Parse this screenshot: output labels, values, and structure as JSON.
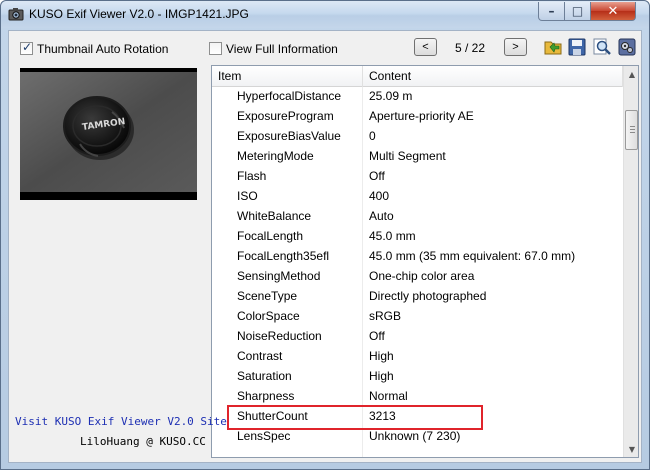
{
  "window": {
    "title": "KUSO Exif Viewer V2.0 - IMGP1421.JPG",
    "minimize_glyph": "–",
    "maximize_glyph": "□",
    "close_glyph": "✕"
  },
  "toolbar": {
    "thumbnail_auto_rotation": {
      "label": "Thumbnail Auto Rotation",
      "checked": true
    },
    "view_full_information": {
      "label": "View Full Information",
      "checked": false
    },
    "prev_glyph": "<",
    "next_glyph": ">",
    "page_indicator": "5 / 22",
    "tools": [
      "open-folder-icon",
      "save-icon",
      "search-icon",
      "settings-icon"
    ]
  },
  "list": {
    "columns": [
      "Item",
      "Content"
    ],
    "rows": [
      {
        "item": "HyperfocalDistance",
        "content": "25.09 m"
      },
      {
        "item": "ExposureProgram",
        "content": "Aperture-priority AE"
      },
      {
        "item": "ExposureBiasValue",
        "content": "0"
      },
      {
        "item": "MeteringMode",
        "content": "Multi Segment"
      },
      {
        "item": "Flash",
        "content": "Off"
      },
      {
        "item": "ISO",
        "content": "400"
      },
      {
        "item": "WhiteBalance",
        "content": "Auto"
      },
      {
        "item": "FocalLength",
        "content": "45.0 mm"
      },
      {
        "item": "FocalLength35efl",
        "content": "45.0 mm (35 mm equivalent: 67.0 mm)"
      },
      {
        "item": "SensingMethod",
        "content": "One-chip color area"
      },
      {
        "item": "SceneType",
        "content": "Directly photographed"
      },
      {
        "item": "ColorSpace",
        "content": "sRGB"
      },
      {
        "item": "NoiseReduction",
        "content": "Off"
      },
      {
        "item": "Contrast",
        "content": "High"
      },
      {
        "item": "Saturation",
        "content": "High"
      },
      {
        "item": "Sharpness",
        "content": "Normal"
      },
      {
        "item": "ShutterCount",
        "content": "3213"
      },
      {
        "item": "LensSpec",
        "content": "Unknown (7 230)"
      }
    ],
    "highlighted_item": "ShutterCount",
    "scrollbar_up_glyph": "▲",
    "scrollbar_down_glyph": "▼"
  },
  "footer": {
    "link": "Visit KUSO Exif Viewer V2.0 Site",
    "author": "LiloHuang @ KUSO.CC"
  },
  "colors": {
    "title_bar": "#c6d9ee",
    "client_bg": "#f0f0f0",
    "link": "#1d2fb3",
    "highlight_border": "#e0242b"
  }
}
